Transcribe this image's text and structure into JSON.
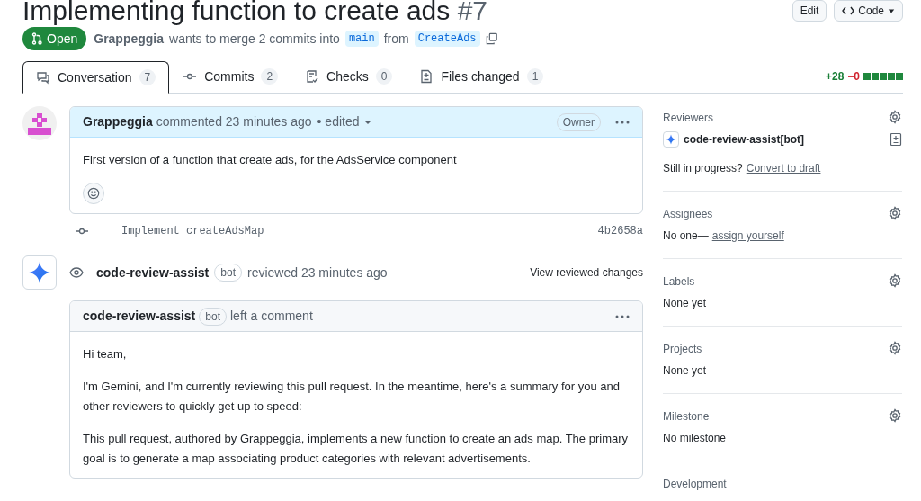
{
  "title": {
    "text": "Implementing function to create ads",
    "number": "#7"
  },
  "header_buttons": [
    {
      "label": "Edit",
      "kind": "plain"
    },
    {
      "label": "Code",
      "kind": "code"
    }
  ],
  "status": {
    "label": "Open",
    "author": "Grappeggia",
    "text_before": "wants to merge 2 commits into",
    "base": "main",
    "text_middle": "from",
    "head": "CreateAds"
  },
  "tabs": [
    {
      "label": "Conversation",
      "count": "7",
      "selected": true
    },
    {
      "label": "Commits",
      "count": "2",
      "selected": false
    },
    {
      "label": "Checks",
      "count": "0",
      "selected": false
    },
    {
      "label": "Files changed",
      "count": "1",
      "selected": false
    }
  ],
  "diffstat": {
    "added": "+28",
    "removed": "−0"
  },
  "timeline": [
    {
      "kind": "comment",
      "author": "Grappeggia",
      "action": "commented 23 minutes ago",
      "edited": "• edited",
      "badge": "Owner",
      "highlight": true,
      "paragraphs": [
        "First version of a function that create ads, for the AdsService component"
      ],
      "reaction": true
    },
    {
      "kind": "commit",
      "message": "Implement createAdsMap",
      "sha": "4b2658a"
    },
    {
      "kind": "review",
      "author": "code-review-assist",
      "badge": "bot",
      "action": "reviewed 23 minutes ago",
      "link": "View reviewed changes"
    },
    {
      "kind": "comment",
      "author": "code-review-assist",
      "badge": "bot",
      "action": "left a comment",
      "highlight": false,
      "paragraphs": [
        "Hi team,",
        "I'm Gemini, and I'm currently reviewing this pull request. In the meantime, here's a summary for you and other reviewers to quickly get up to speed:",
        "This pull request, authored by Grappeggia, implements a new function to create an ads map. The primary goal is to generate a map associating product categories with relevant advertisements."
      ],
      "reaction": false
    }
  ],
  "sidebar": [
    {
      "title": "Reviewers",
      "gear": true,
      "reviewer": "code-review-assist[bot]",
      "note": "Still in progress?",
      "link": "Convert to draft"
    },
    {
      "title": "Assignees",
      "gear": true,
      "note": "No one—",
      "link": "assign yourself"
    },
    {
      "title": "Labels",
      "gear": true,
      "note": "None yet"
    },
    {
      "title": "Projects",
      "gear": true,
      "note": "None yet"
    },
    {
      "title": "Milestone",
      "gear": true,
      "note": "No milestone"
    },
    {
      "title": "Development",
      "gear": false
    }
  ]
}
